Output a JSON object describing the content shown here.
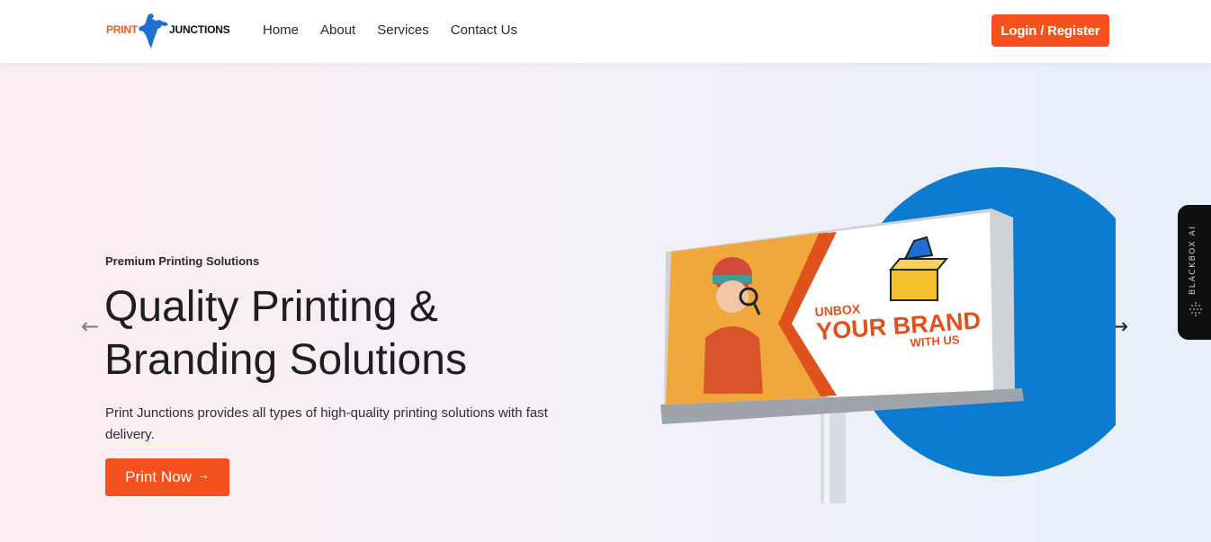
{
  "brand": {
    "logo_left": "PRINT",
    "logo_right": "JUNCTIONS",
    "accent": "#f4511e",
    "map_color": "#1e6fd2"
  },
  "nav": {
    "items": [
      {
        "label": "Home"
      },
      {
        "label": "About"
      },
      {
        "label": "Services"
      },
      {
        "label": "Contact Us"
      }
    ]
  },
  "header": {
    "login_label": "Login / Register"
  },
  "hero": {
    "eyebrow": "Premium Printing Solutions",
    "headline_line1": "Quality Printing &",
    "headline_line2": "Branding Solutions",
    "description": "Print Junctions provides all types of high-quality printing solutions with fast delivery.",
    "cta_label": "Print Now",
    "cta_icon": "arrow-right-icon",
    "prev_icon": "arrow-left-icon",
    "next_icon": "arrow-right-icon"
  },
  "billboard": {
    "line1": "UNBOX",
    "line2": "YOUR BRAND",
    "line3": "WITH US",
    "circle_color": "#0b7ccf"
  },
  "side_widget": {
    "label": "BLACKBOX AI"
  }
}
